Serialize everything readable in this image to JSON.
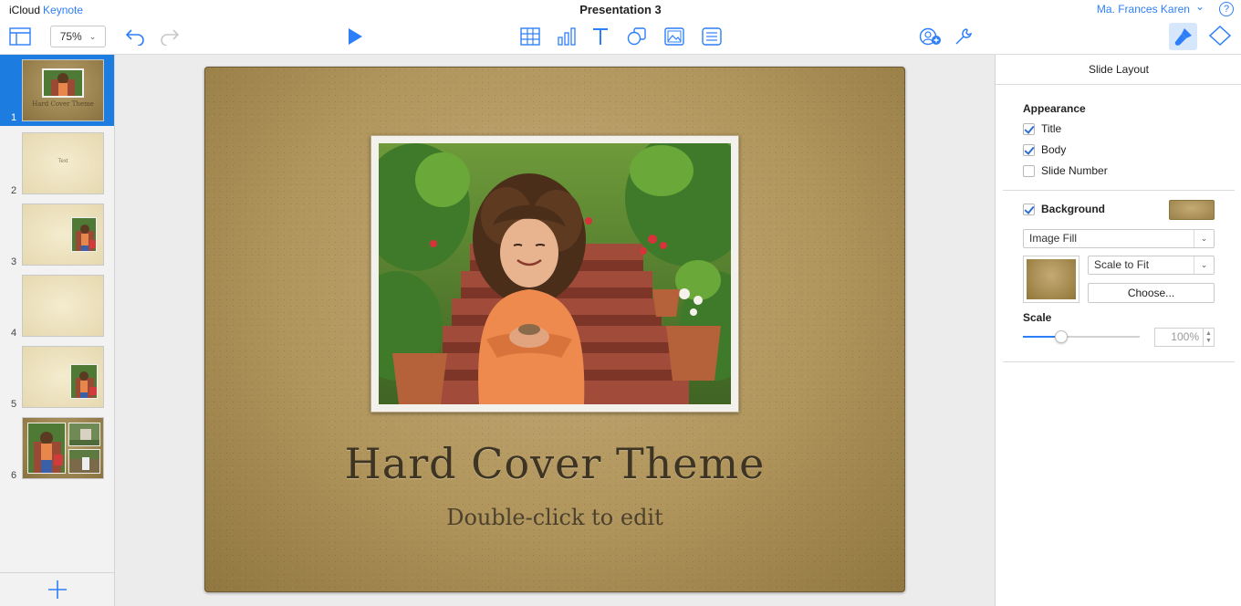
{
  "topbar": {
    "brand_icloud": "iCloud",
    "brand_app": "Keynote",
    "document_title": "Presentation 3",
    "user_name": "Ma. Frances Karen",
    "user_chevron": "⌄",
    "help_symbol": "?",
    "zoom_value": "75%",
    "zoom_chevron": "⌄"
  },
  "navigator": {
    "slides": [
      {
        "number": "1",
        "thumb_title": "Hard Cover Theme"
      },
      {
        "number": "2",
        "thumb_text": "Text"
      },
      {
        "number": "3"
      },
      {
        "number": "4"
      },
      {
        "number": "5"
      },
      {
        "number": "6"
      }
    ]
  },
  "slide": {
    "title": "Hard Cover Theme",
    "subtitle": "Double-click to edit"
  },
  "inspector": {
    "header": "Slide Layout",
    "appearance_label": "Appearance",
    "title_label": "Title",
    "body_label": "Body",
    "slide_number_label": "Slide Number",
    "background_label": "Background",
    "fill_type": "Image Fill",
    "scale_mode": "Scale to Fit",
    "choose_label": "Choose...",
    "scale_label": "Scale",
    "scale_value": "100%",
    "scale_fraction": 0.33,
    "title_checked": true,
    "body_checked": true,
    "slide_number_checked": false,
    "background_checked": true
  },
  "colors": {
    "accent": "#2d7ff9",
    "selected_slide": "#1d7ce0",
    "kraft": "#b0955c"
  }
}
